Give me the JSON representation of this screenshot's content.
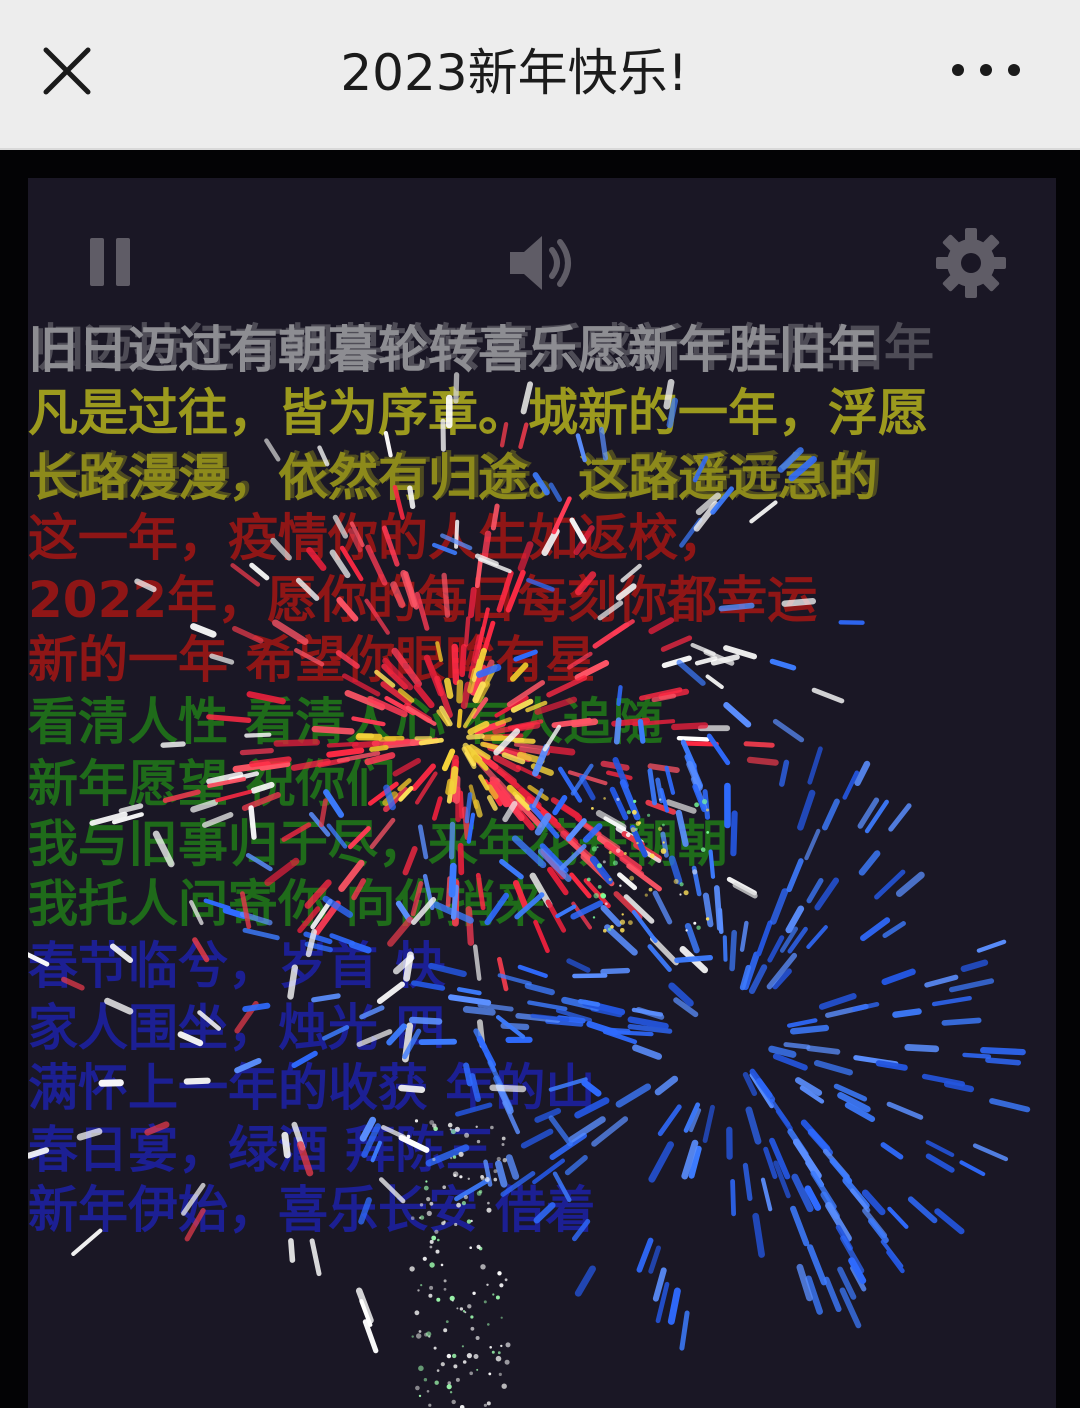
{
  "header": {
    "title": "2023新年快乐!",
    "close_icon": "close-icon",
    "more_icon": "more-dots-icon"
  },
  "controls": {
    "pause_icon": "pause-icon",
    "sound_icon": "speaker-icon",
    "settings_icon": "gear-icon"
  },
  "colors": {
    "header_bg": "#ededed",
    "stage_bg": "#1a1725",
    "control_icon": "#5f5c66",
    "gray_text": "#8a8a8e",
    "yellow_text": "#9c9a1e",
    "red_text": "#8f1616",
    "green_text": "#1f6b1a",
    "blue_text": "#1c1f93"
  },
  "wishes": [
    {
      "text": "旧日迈过有朝暮轮转喜乐愿新年胜旧年",
      "color": "#8d8d92"
    },
    {
      "text": "凡是过往，皆为序章。城新的一年，浮愿",
      "color": "#9c9a1e"
    },
    {
      "text": "长路漫漫，依然有归途。这路遥远急的",
      "color": "#8d8a1b"
    },
    {
      "text": "这一年，疫情你的人生如返校，",
      "color": "#8f1616"
    },
    {
      "text": "2022年，愿你的每日每刻你都幸运",
      "color": "#8f1616"
    },
    {
      "text": "新的一年 希望你眼眸有星",
      "color": "#8f1616"
    },
    {
      "text": "看清人性 看清人心 有人追随",
      "color": "#1f6b1a"
    },
    {
      "text": "新年愿望 祝你们",
      "color": "#1f6b1a"
    },
    {
      "text": "我与旧事归于尽，来年花开朝朝",
      "color": "#1f6b1a"
    },
    {
      "text": "我托人间寄你 向你捎来",
      "color": "#1f6b1a"
    },
    {
      "text": "春节临兮，岁首 快",
      "color": "#1c1f93"
    },
    {
      "text": "家人围坐，烛光 四",
      "color": "#1c1f93"
    },
    {
      "text": "满怀上一年的收获 年的山",
      "color": "#1c1f93"
    },
    {
      "text": "春日宴，绿酒 拜陈三",
      "color": "#1c1f93"
    },
    {
      "text": "新年伊始，喜乐长安 借着",
      "color": "#1c1f93"
    }
  ],
  "ghost_lines": [
    {
      "text": "归迈持征有朝暮轮转喜乐感新年年胜旧年",
      "color": "#8d8d92"
    },
    {
      "text": "长路漫漫，依然有归途。这路遥遥急的",
      "color": "#8d8a1b"
    }
  ]
}
